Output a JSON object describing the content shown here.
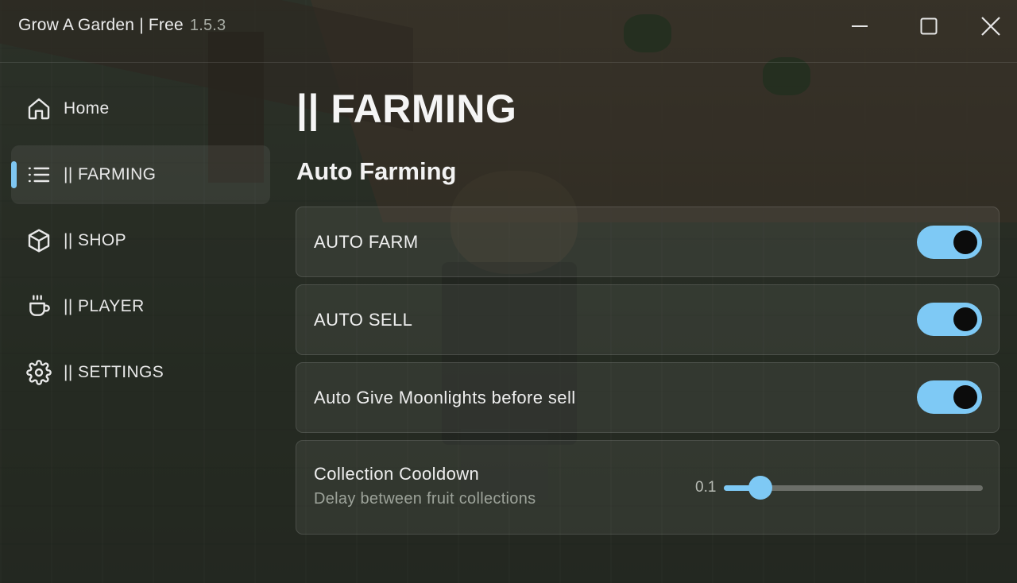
{
  "window": {
    "title": "Grow A Garden | Free",
    "version": "1.5.3",
    "controls": [
      "minimize-icon",
      "maximize-icon",
      "close-icon"
    ]
  },
  "sidebar": {
    "items": [
      {
        "label": "Home",
        "icon": "home-icon",
        "active": false
      },
      {
        "label": "|| FARMING",
        "icon": "list-icon",
        "active": true
      },
      {
        "label": "|| SHOP",
        "icon": "cube-icon",
        "active": false
      },
      {
        "label": "|| PLAYER",
        "icon": "cup-icon",
        "active": false
      },
      {
        "label": "|| SETTINGS",
        "icon": "gear-icon",
        "active": false
      }
    ]
  },
  "main": {
    "title": "|| FARMING",
    "section": "Auto Farming",
    "toggles": [
      {
        "label": "AUTO FARM",
        "on": true
      },
      {
        "label": "AUTO SELL",
        "on": true
      },
      {
        "label": "Auto Give Moonlights before sell",
        "on": true
      }
    ],
    "slider": {
      "label": "Collection Cooldown",
      "description": "Delay between fruit collections",
      "value_text": "0.1",
      "fill_fraction": 0.14
    }
  },
  "colors": {
    "accent": "#7ec9f5",
    "toggle_knob": "#0c0c0c",
    "text_primary": "#f2f2f2",
    "text_secondary": "#9da39a"
  }
}
